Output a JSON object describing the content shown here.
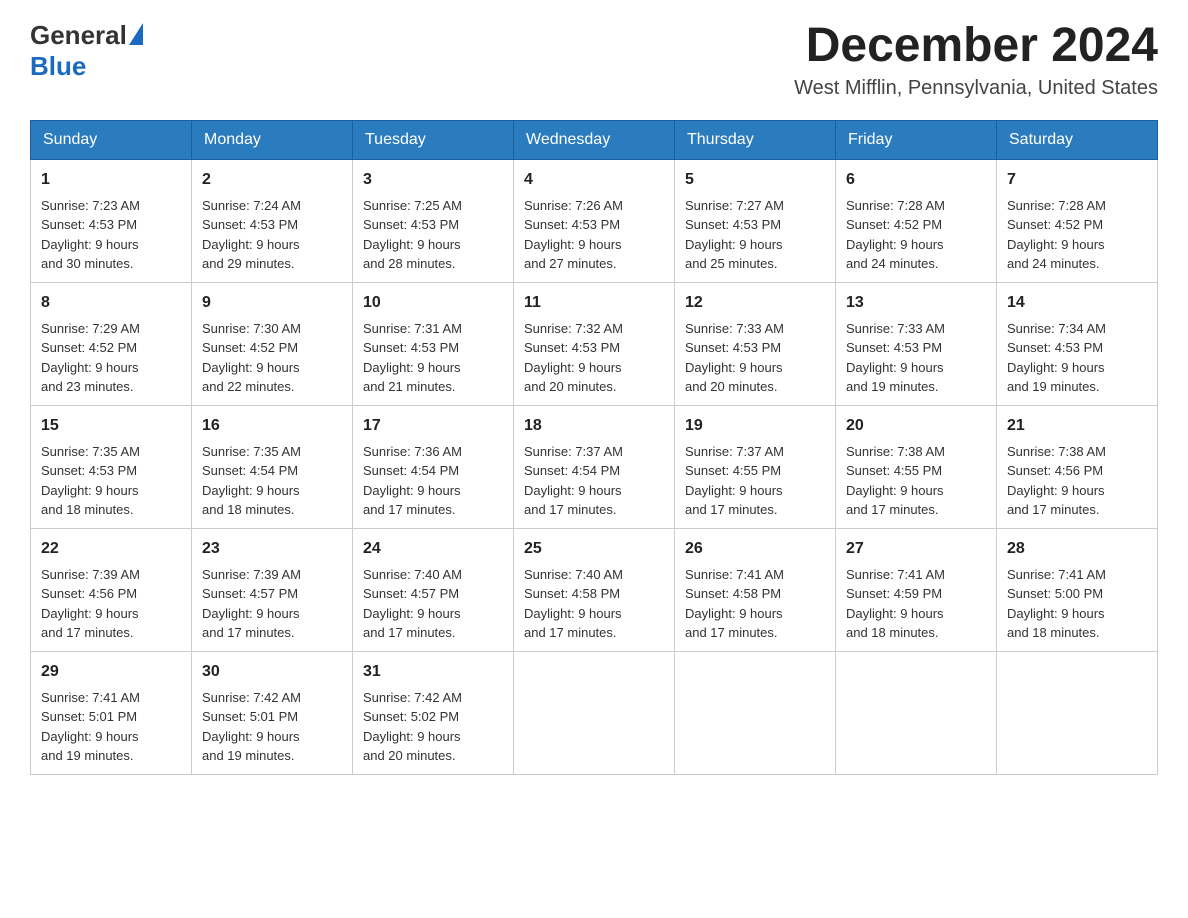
{
  "header": {
    "logo_general": "General",
    "logo_blue": "Blue",
    "month_title": "December 2024",
    "location": "West Mifflin, Pennsylvania, United States"
  },
  "weekdays": [
    "Sunday",
    "Monday",
    "Tuesday",
    "Wednesday",
    "Thursday",
    "Friday",
    "Saturday"
  ],
  "weeks": [
    [
      {
        "day": "1",
        "sunrise": "7:23 AM",
        "sunset": "4:53 PM",
        "daylight": "9 hours and 30 minutes."
      },
      {
        "day": "2",
        "sunrise": "7:24 AM",
        "sunset": "4:53 PM",
        "daylight": "9 hours and 29 minutes."
      },
      {
        "day": "3",
        "sunrise": "7:25 AM",
        "sunset": "4:53 PM",
        "daylight": "9 hours and 28 minutes."
      },
      {
        "day": "4",
        "sunrise": "7:26 AM",
        "sunset": "4:53 PM",
        "daylight": "9 hours and 27 minutes."
      },
      {
        "day": "5",
        "sunrise": "7:27 AM",
        "sunset": "4:53 PM",
        "daylight": "9 hours and 25 minutes."
      },
      {
        "day": "6",
        "sunrise": "7:28 AM",
        "sunset": "4:52 PM",
        "daylight": "9 hours and 24 minutes."
      },
      {
        "day": "7",
        "sunrise": "7:28 AM",
        "sunset": "4:52 PM",
        "daylight": "9 hours and 24 minutes."
      }
    ],
    [
      {
        "day": "8",
        "sunrise": "7:29 AM",
        "sunset": "4:52 PM",
        "daylight": "9 hours and 23 minutes."
      },
      {
        "day": "9",
        "sunrise": "7:30 AM",
        "sunset": "4:52 PM",
        "daylight": "9 hours and 22 minutes."
      },
      {
        "day": "10",
        "sunrise": "7:31 AM",
        "sunset": "4:53 PM",
        "daylight": "9 hours and 21 minutes."
      },
      {
        "day": "11",
        "sunrise": "7:32 AM",
        "sunset": "4:53 PM",
        "daylight": "9 hours and 20 minutes."
      },
      {
        "day": "12",
        "sunrise": "7:33 AM",
        "sunset": "4:53 PM",
        "daylight": "9 hours and 20 minutes."
      },
      {
        "day": "13",
        "sunrise": "7:33 AM",
        "sunset": "4:53 PM",
        "daylight": "9 hours and 19 minutes."
      },
      {
        "day": "14",
        "sunrise": "7:34 AM",
        "sunset": "4:53 PM",
        "daylight": "9 hours and 19 minutes."
      }
    ],
    [
      {
        "day": "15",
        "sunrise": "7:35 AM",
        "sunset": "4:53 PM",
        "daylight": "9 hours and 18 minutes."
      },
      {
        "day": "16",
        "sunrise": "7:35 AM",
        "sunset": "4:54 PM",
        "daylight": "9 hours and 18 minutes."
      },
      {
        "day": "17",
        "sunrise": "7:36 AM",
        "sunset": "4:54 PM",
        "daylight": "9 hours and 17 minutes."
      },
      {
        "day": "18",
        "sunrise": "7:37 AM",
        "sunset": "4:54 PM",
        "daylight": "9 hours and 17 minutes."
      },
      {
        "day": "19",
        "sunrise": "7:37 AM",
        "sunset": "4:55 PM",
        "daylight": "9 hours and 17 minutes."
      },
      {
        "day": "20",
        "sunrise": "7:38 AM",
        "sunset": "4:55 PM",
        "daylight": "9 hours and 17 minutes."
      },
      {
        "day": "21",
        "sunrise": "7:38 AM",
        "sunset": "4:56 PM",
        "daylight": "9 hours and 17 minutes."
      }
    ],
    [
      {
        "day": "22",
        "sunrise": "7:39 AM",
        "sunset": "4:56 PM",
        "daylight": "9 hours and 17 minutes."
      },
      {
        "day": "23",
        "sunrise": "7:39 AM",
        "sunset": "4:57 PM",
        "daylight": "9 hours and 17 minutes."
      },
      {
        "day": "24",
        "sunrise": "7:40 AM",
        "sunset": "4:57 PM",
        "daylight": "9 hours and 17 minutes."
      },
      {
        "day": "25",
        "sunrise": "7:40 AM",
        "sunset": "4:58 PM",
        "daylight": "9 hours and 17 minutes."
      },
      {
        "day": "26",
        "sunrise": "7:41 AM",
        "sunset": "4:58 PM",
        "daylight": "9 hours and 17 minutes."
      },
      {
        "day": "27",
        "sunrise": "7:41 AM",
        "sunset": "4:59 PM",
        "daylight": "9 hours and 18 minutes."
      },
      {
        "day": "28",
        "sunrise": "7:41 AM",
        "sunset": "5:00 PM",
        "daylight": "9 hours and 18 minutes."
      }
    ],
    [
      {
        "day": "29",
        "sunrise": "7:41 AM",
        "sunset": "5:01 PM",
        "daylight": "9 hours and 19 minutes."
      },
      {
        "day": "30",
        "sunrise": "7:42 AM",
        "sunset": "5:01 PM",
        "daylight": "9 hours and 19 minutes."
      },
      {
        "day": "31",
        "sunrise": "7:42 AM",
        "sunset": "5:02 PM",
        "daylight": "9 hours and 20 minutes."
      },
      null,
      null,
      null,
      null
    ]
  ],
  "labels": {
    "sunrise": "Sunrise:",
    "sunset": "Sunset:",
    "daylight": "Daylight:"
  }
}
